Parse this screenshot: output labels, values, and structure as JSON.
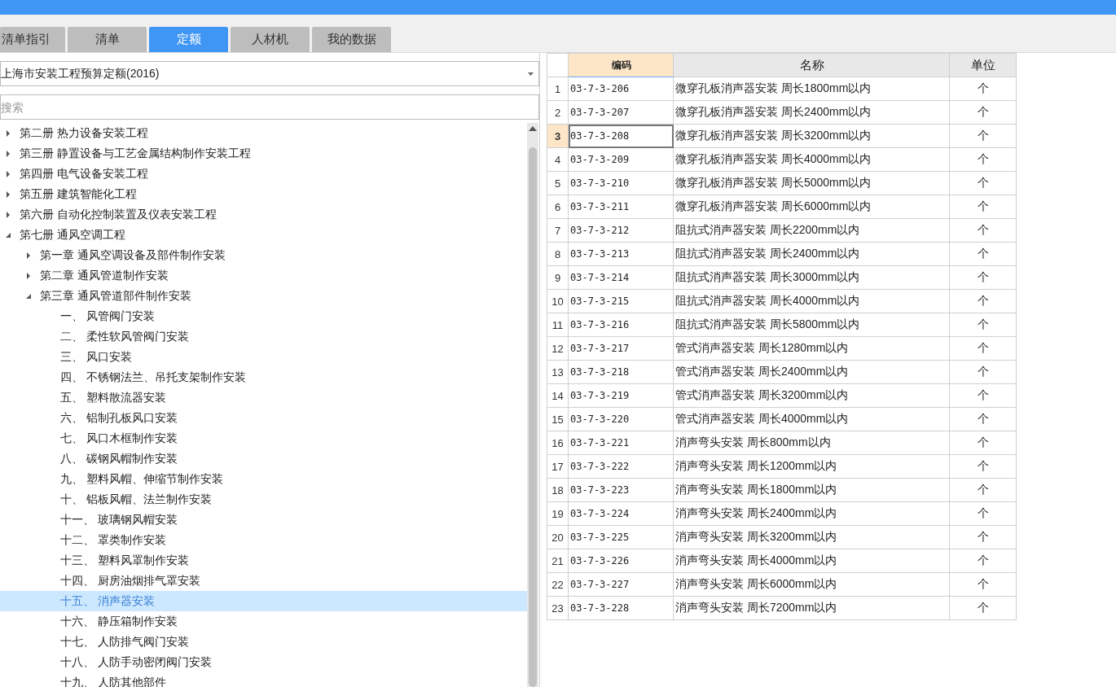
{
  "tabs": [
    {
      "label": "清单指引",
      "selected": false
    },
    {
      "label": "清单",
      "selected": false
    },
    {
      "label": "定额",
      "selected": true
    },
    {
      "label": "人材机",
      "selected": false
    },
    {
      "label": "我的数据",
      "selected": false
    }
  ],
  "library_select": {
    "value": "上海市安装工程预算定额(2016)"
  },
  "search": {
    "placeholder": "搜索"
  },
  "tree": [
    {
      "label": "第二册 热力设备安装工程",
      "expanded": false,
      "selected": false
    },
    {
      "label": "第三册 静置设备与工艺金属结构制作安装工程",
      "expanded": false,
      "selected": false
    },
    {
      "label": "第四册 电气设备安装工程",
      "expanded": false,
      "selected": false
    },
    {
      "label": "第五册 建筑智能化工程",
      "expanded": false,
      "selected": false
    },
    {
      "label": "第六册 自动化控制装置及仪表安装工程",
      "expanded": false,
      "selected": false
    },
    {
      "label": "第七册 通风空调工程",
      "expanded": true,
      "selected": false,
      "children": [
        {
          "label": "第一章 通风空调设备及部件制作安装",
          "expanded": false,
          "selected": false
        },
        {
          "label": "第二章 通风管道制作安装",
          "expanded": false,
          "selected": false
        },
        {
          "label": "第三章 通风管道部件制作安装",
          "expanded": true,
          "selected": false,
          "children": [
            {
              "label": "一、 风管阀门安装",
              "selected": false
            },
            {
              "label": "二、 柔性软风管阀门安装",
              "selected": false
            },
            {
              "label": "三、 风口安装",
              "selected": false
            },
            {
              "label": "四、 不锈钢法兰、吊托支架制作安装",
              "selected": false
            },
            {
              "label": "五、 塑料散流器安装",
              "selected": false
            },
            {
              "label": "六、 铝制孔板风口安装",
              "selected": false
            },
            {
              "label": "七、 风口木框制作安装",
              "selected": false
            },
            {
              "label": "八、 碳钢风帽制作安装",
              "selected": false
            },
            {
              "label": "九、 塑料风帽、伸缩节制作安装",
              "selected": false
            },
            {
              "label": "十、 铝板风帽、法兰制作安装",
              "selected": false
            },
            {
              "label": "十一、 玻璃钢风帽安装",
              "selected": false
            },
            {
              "label": "十二、 罩类制作安装",
              "selected": false
            },
            {
              "label": "十三、 塑料风罩制作安装",
              "selected": false
            },
            {
              "label": "十四、 厨房油烟排气罩安装",
              "selected": false
            },
            {
              "label": "十五、 消声器安装",
              "selected": true
            },
            {
              "label": "十六、 静压箱制作安装",
              "selected": false
            },
            {
              "label": "十七、 人防排气阀门安装",
              "selected": false
            },
            {
              "label": "十八、 人防手动密闭阀门安装",
              "selected": false
            },
            {
              "label": "十九、 人防其他部件",
              "selected": false
            }
          ]
        }
      ]
    }
  ],
  "table": {
    "columns": [
      "编码",
      "名称",
      "单位"
    ],
    "rows": [
      {
        "index": "1",
        "code": "03-7-3-206",
        "name": "微穿孔板消声器安装  周长1800mm以内",
        "unit": "个",
        "selected": false
      },
      {
        "index": "2",
        "code": "03-7-3-207",
        "name": "微穿孔板消声器安装  周长2400mm以内",
        "unit": "个",
        "selected": false
      },
      {
        "index": "3",
        "code": "03-7-3-208",
        "name": "微穿孔板消声器安装  周长3200mm以内",
        "unit": "个",
        "selected": true
      },
      {
        "index": "4",
        "code": "03-7-3-209",
        "name": "微穿孔板消声器安装  周长4000mm以内",
        "unit": "个",
        "selected": false
      },
      {
        "index": "5",
        "code": "03-7-3-210",
        "name": "微穿孔板消声器安装  周长5000mm以内",
        "unit": "个",
        "selected": false
      },
      {
        "index": "6",
        "code": "03-7-3-211",
        "name": "微穿孔板消声器安装  周长6000mm以内",
        "unit": "个",
        "selected": false
      },
      {
        "index": "7",
        "code": "03-7-3-212",
        "name": "阻抗式消声器安装  周长2200mm以内",
        "unit": "个",
        "selected": false
      },
      {
        "index": "8",
        "code": "03-7-3-213",
        "name": "阻抗式消声器安装  周长2400mm以内",
        "unit": "个",
        "selected": false
      },
      {
        "index": "9",
        "code": "03-7-3-214",
        "name": "阻抗式消声器安装  周长3000mm以内",
        "unit": "个",
        "selected": false
      },
      {
        "index": "10",
        "code": "03-7-3-215",
        "name": "阻抗式消声器安装  周长4000mm以内",
        "unit": "个",
        "selected": false
      },
      {
        "index": "11",
        "code": "03-7-3-216",
        "name": "阻抗式消声器安装  周长5800mm以内",
        "unit": "个",
        "selected": false
      },
      {
        "index": "12",
        "code": "03-7-3-217",
        "name": "管式消声器安装  周长1280mm以内",
        "unit": "个",
        "selected": false
      },
      {
        "index": "13",
        "code": "03-7-3-218",
        "name": "管式消声器安装  周长2400mm以内",
        "unit": "个",
        "selected": false
      },
      {
        "index": "14",
        "code": "03-7-3-219",
        "name": "管式消声器安装  周长3200mm以内",
        "unit": "个",
        "selected": false
      },
      {
        "index": "15",
        "code": "03-7-3-220",
        "name": "管式消声器安装  周长4000mm以内",
        "unit": "个",
        "selected": false
      },
      {
        "index": "16",
        "code": "03-7-3-221",
        "name": "消声弯头安装  周长800mm以内",
        "unit": "个",
        "selected": false
      },
      {
        "index": "17",
        "code": "03-7-3-222",
        "name": "消声弯头安装  周长1200mm以内",
        "unit": "个",
        "selected": false
      },
      {
        "index": "18",
        "code": "03-7-3-223",
        "name": "消声弯头安装  周长1800mm以内",
        "unit": "个",
        "selected": false
      },
      {
        "index": "19",
        "code": "03-7-3-224",
        "name": "消声弯头安装  周长2400mm以内",
        "unit": "个",
        "selected": false
      },
      {
        "index": "20",
        "code": "03-7-3-225",
        "name": "消声弯头安装  周长3200mm以内",
        "unit": "个",
        "selected": false
      },
      {
        "index": "21",
        "code": "03-7-3-226",
        "name": "消声弯头安装  周长4000mm以内",
        "unit": "个",
        "selected": false
      },
      {
        "index": "22",
        "code": "03-7-3-227",
        "name": "消声弯头安装  周长6000mm以内",
        "unit": "个",
        "selected": false
      },
      {
        "index": "23",
        "code": "03-7-3-228",
        "name": "消声弯头安装  周长7200mm以内",
        "unit": "个",
        "selected": false
      }
    ]
  }
}
